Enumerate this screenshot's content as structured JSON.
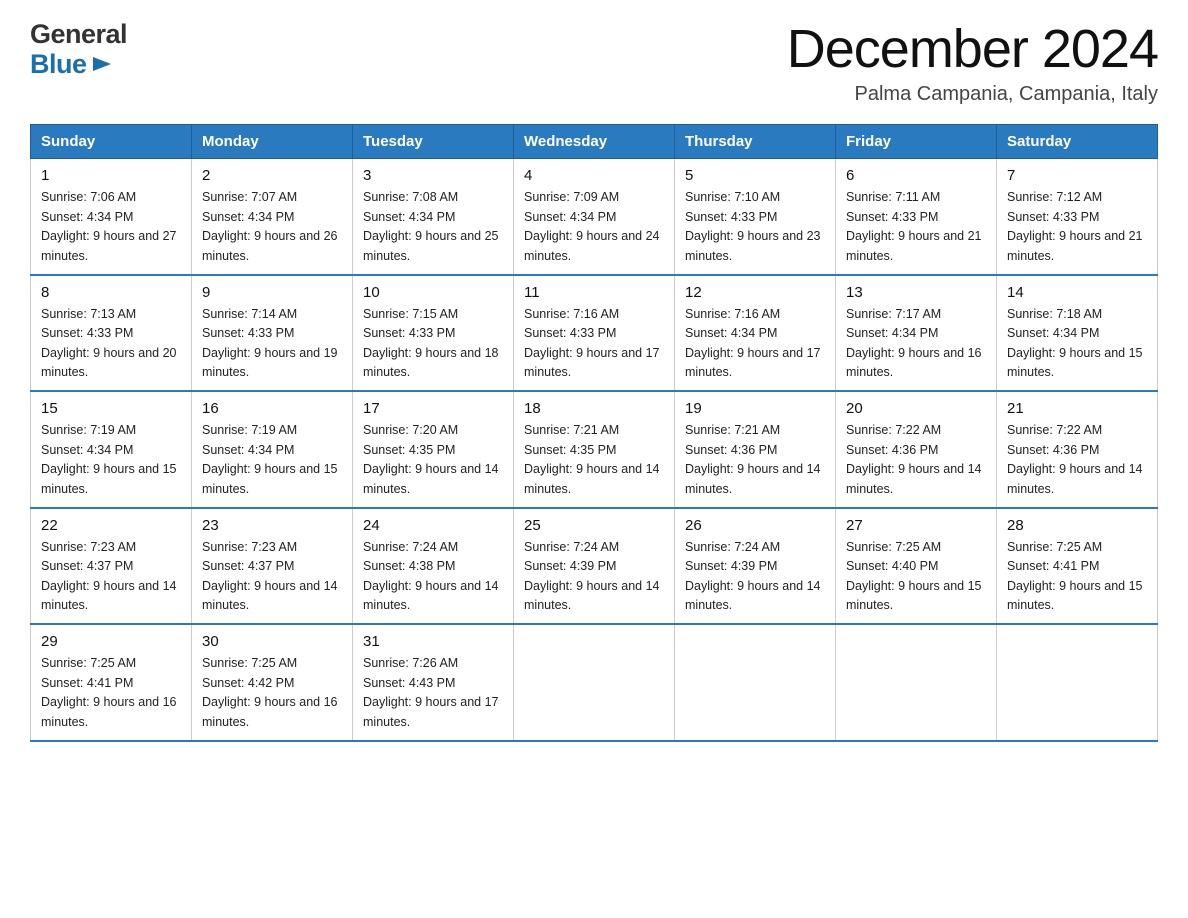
{
  "logo": {
    "general": "General",
    "blue": "Blue"
  },
  "title": "December 2024",
  "subtitle": "Palma Campania, Campania, Italy",
  "days_header": [
    "Sunday",
    "Monday",
    "Tuesday",
    "Wednesday",
    "Thursday",
    "Friday",
    "Saturday"
  ],
  "weeks": [
    [
      {
        "num": "1",
        "sunrise": "7:06 AM",
        "sunset": "4:34 PM",
        "daylight": "9 hours and 27 minutes."
      },
      {
        "num": "2",
        "sunrise": "7:07 AM",
        "sunset": "4:34 PM",
        "daylight": "9 hours and 26 minutes."
      },
      {
        "num": "3",
        "sunrise": "7:08 AM",
        "sunset": "4:34 PM",
        "daylight": "9 hours and 25 minutes."
      },
      {
        "num": "4",
        "sunrise": "7:09 AM",
        "sunset": "4:34 PM",
        "daylight": "9 hours and 24 minutes."
      },
      {
        "num": "5",
        "sunrise": "7:10 AM",
        "sunset": "4:33 PM",
        "daylight": "9 hours and 23 minutes."
      },
      {
        "num": "6",
        "sunrise": "7:11 AM",
        "sunset": "4:33 PM",
        "daylight": "9 hours and 21 minutes."
      },
      {
        "num": "7",
        "sunrise": "7:12 AM",
        "sunset": "4:33 PM",
        "daylight": "9 hours and 21 minutes."
      }
    ],
    [
      {
        "num": "8",
        "sunrise": "7:13 AM",
        "sunset": "4:33 PM",
        "daylight": "9 hours and 20 minutes."
      },
      {
        "num": "9",
        "sunrise": "7:14 AM",
        "sunset": "4:33 PM",
        "daylight": "9 hours and 19 minutes."
      },
      {
        "num": "10",
        "sunrise": "7:15 AM",
        "sunset": "4:33 PM",
        "daylight": "9 hours and 18 minutes."
      },
      {
        "num": "11",
        "sunrise": "7:16 AM",
        "sunset": "4:33 PM",
        "daylight": "9 hours and 17 minutes."
      },
      {
        "num": "12",
        "sunrise": "7:16 AM",
        "sunset": "4:34 PM",
        "daylight": "9 hours and 17 minutes."
      },
      {
        "num": "13",
        "sunrise": "7:17 AM",
        "sunset": "4:34 PM",
        "daylight": "9 hours and 16 minutes."
      },
      {
        "num": "14",
        "sunrise": "7:18 AM",
        "sunset": "4:34 PM",
        "daylight": "9 hours and 15 minutes."
      }
    ],
    [
      {
        "num": "15",
        "sunrise": "7:19 AM",
        "sunset": "4:34 PM",
        "daylight": "9 hours and 15 minutes."
      },
      {
        "num": "16",
        "sunrise": "7:19 AM",
        "sunset": "4:34 PM",
        "daylight": "9 hours and 15 minutes."
      },
      {
        "num": "17",
        "sunrise": "7:20 AM",
        "sunset": "4:35 PM",
        "daylight": "9 hours and 14 minutes."
      },
      {
        "num": "18",
        "sunrise": "7:21 AM",
        "sunset": "4:35 PM",
        "daylight": "9 hours and 14 minutes."
      },
      {
        "num": "19",
        "sunrise": "7:21 AM",
        "sunset": "4:36 PM",
        "daylight": "9 hours and 14 minutes."
      },
      {
        "num": "20",
        "sunrise": "7:22 AM",
        "sunset": "4:36 PM",
        "daylight": "9 hours and 14 minutes."
      },
      {
        "num": "21",
        "sunrise": "7:22 AM",
        "sunset": "4:36 PM",
        "daylight": "9 hours and 14 minutes."
      }
    ],
    [
      {
        "num": "22",
        "sunrise": "7:23 AM",
        "sunset": "4:37 PM",
        "daylight": "9 hours and 14 minutes."
      },
      {
        "num": "23",
        "sunrise": "7:23 AM",
        "sunset": "4:37 PM",
        "daylight": "9 hours and 14 minutes."
      },
      {
        "num": "24",
        "sunrise": "7:24 AM",
        "sunset": "4:38 PM",
        "daylight": "9 hours and 14 minutes."
      },
      {
        "num": "25",
        "sunrise": "7:24 AM",
        "sunset": "4:39 PM",
        "daylight": "9 hours and 14 minutes."
      },
      {
        "num": "26",
        "sunrise": "7:24 AM",
        "sunset": "4:39 PM",
        "daylight": "9 hours and 14 minutes."
      },
      {
        "num": "27",
        "sunrise": "7:25 AM",
        "sunset": "4:40 PM",
        "daylight": "9 hours and 15 minutes."
      },
      {
        "num": "28",
        "sunrise": "7:25 AM",
        "sunset": "4:41 PM",
        "daylight": "9 hours and 15 minutes."
      }
    ],
    [
      {
        "num": "29",
        "sunrise": "7:25 AM",
        "sunset": "4:41 PM",
        "daylight": "9 hours and 16 minutes."
      },
      {
        "num": "30",
        "sunrise": "7:25 AM",
        "sunset": "4:42 PM",
        "daylight": "9 hours and 16 minutes."
      },
      {
        "num": "31",
        "sunrise": "7:26 AM",
        "sunset": "4:43 PM",
        "daylight": "9 hours and 17 minutes."
      },
      null,
      null,
      null,
      null
    ]
  ]
}
